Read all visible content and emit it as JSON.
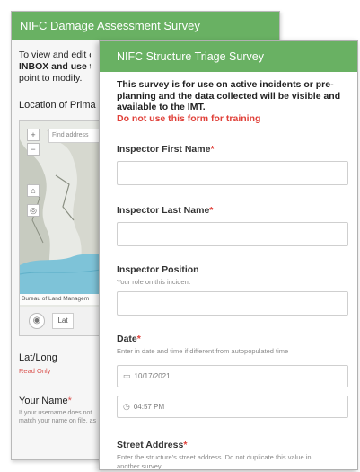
{
  "back_form": {
    "header": "NIFC Damage Assessment Survey",
    "intro_lines": [
      "To view and edit e",
      "INBOX and use th",
      "point to modify."
    ],
    "inbox_word": "INBOX",
    "location_label": "Location of Prima",
    "map": {
      "search_placeholder": "Find address",
      "attribution": "Bureau of Land Managem",
      "lat_button": "Lat"
    },
    "latlong_label": "Lat/Long",
    "read_only": "Read Only",
    "your_name_label": "Your Name",
    "your_name_hint": "If your username does not match your name on file, as"
  },
  "front_form": {
    "header": "NIFC Structure Triage Survey",
    "intro_lines": [
      "This survey is for use on active incidents or pre-",
      "planning and the data collected will be visible and",
      "available to the IMT."
    ],
    "warning": "Do not use this form for training",
    "questions": {
      "inspector_first": {
        "label": "Inspector First Name"
      },
      "inspector_last": {
        "label": "Inspector Last Name"
      },
      "inspector_position": {
        "label": "Inspector Position",
        "hint": "Your role on this incident"
      },
      "date": {
        "label": "Date",
        "hint": "Enter in date and time if different from autopopulated time",
        "date_value": "10/17/2021",
        "time_value": "04:57 PM"
      },
      "street_address": {
        "label": "Street Address",
        "hint_lines": [
          "Enter the structure's street address. Do not duplicate this value in",
          "another survey."
        ]
      }
    },
    "required_marker": "*"
  },
  "colors": {
    "header_green": "#69b163",
    "required_red": "#e0413a"
  },
  "icons": {
    "calendar": "calendar-icon",
    "clock": "clock-icon",
    "locate": "locate-icon"
  }
}
